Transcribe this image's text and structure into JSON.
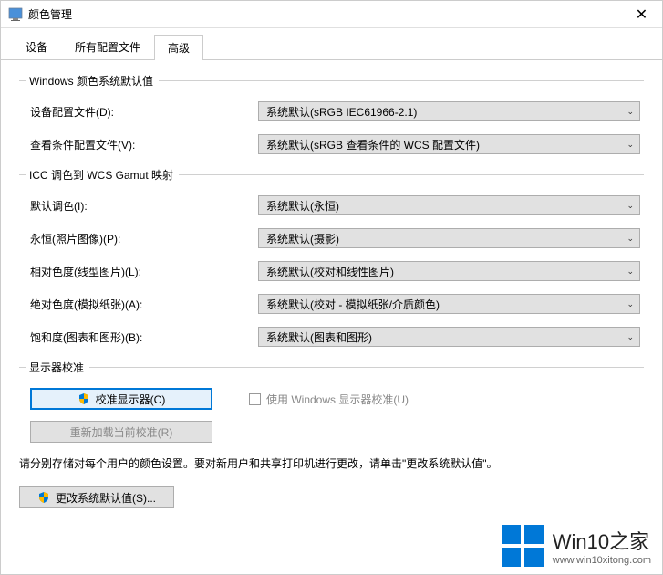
{
  "window": {
    "title": "颜色管理",
    "close": "✕"
  },
  "tabs": {
    "devices": "设备",
    "all_profiles": "所有配置文件",
    "advanced": "高级"
  },
  "group_defaults": {
    "legend": "Windows 颜色系统默认值",
    "device_profile_label": "设备配置文件(D):",
    "device_profile_value": "系统默认(sRGB IEC61966-2.1)",
    "viewing_profile_label": "查看条件配置文件(V):",
    "viewing_profile_value": "系统默认(sRGB 查看条件的 WCS 配置文件)"
  },
  "group_gamut": {
    "legend": "ICC 调色到 WCS Gamut 映射",
    "default_intent_label": "默认调色(I):",
    "default_intent_value": "系统默认(永恒)",
    "perceptual_label": "永恒(照片图像)(P):",
    "perceptual_value": "系统默认(摄影)",
    "relative_label": "相对色度(线型图片)(L):",
    "relative_value": "系统默认(校对和线性图片)",
    "absolute_label": "绝对色度(模拟纸张)(A):",
    "absolute_value": "系统默认(校对 - 模拟纸张/介质颜色)",
    "saturation_label": "饱和度(图表和图形)(B):",
    "saturation_value": "系统默认(图表和图形)"
  },
  "group_calibration": {
    "legend": "显示器校准",
    "calibrate_button": "校准显示器(C)",
    "use_windows_calibration": "使用 Windows 显示器校准(U)",
    "reload_button": "重新加载当前校准(R)"
  },
  "hint": "请分别存储对每个用户的颜色设置。要对新用户和共享打印机进行更改，请单击\"更改系统默认值\"。",
  "change_defaults_button": "更改系统默认值(S)...",
  "watermark": {
    "title": "Win10之家",
    "url": "www.win10xitong.com"
  }
}
